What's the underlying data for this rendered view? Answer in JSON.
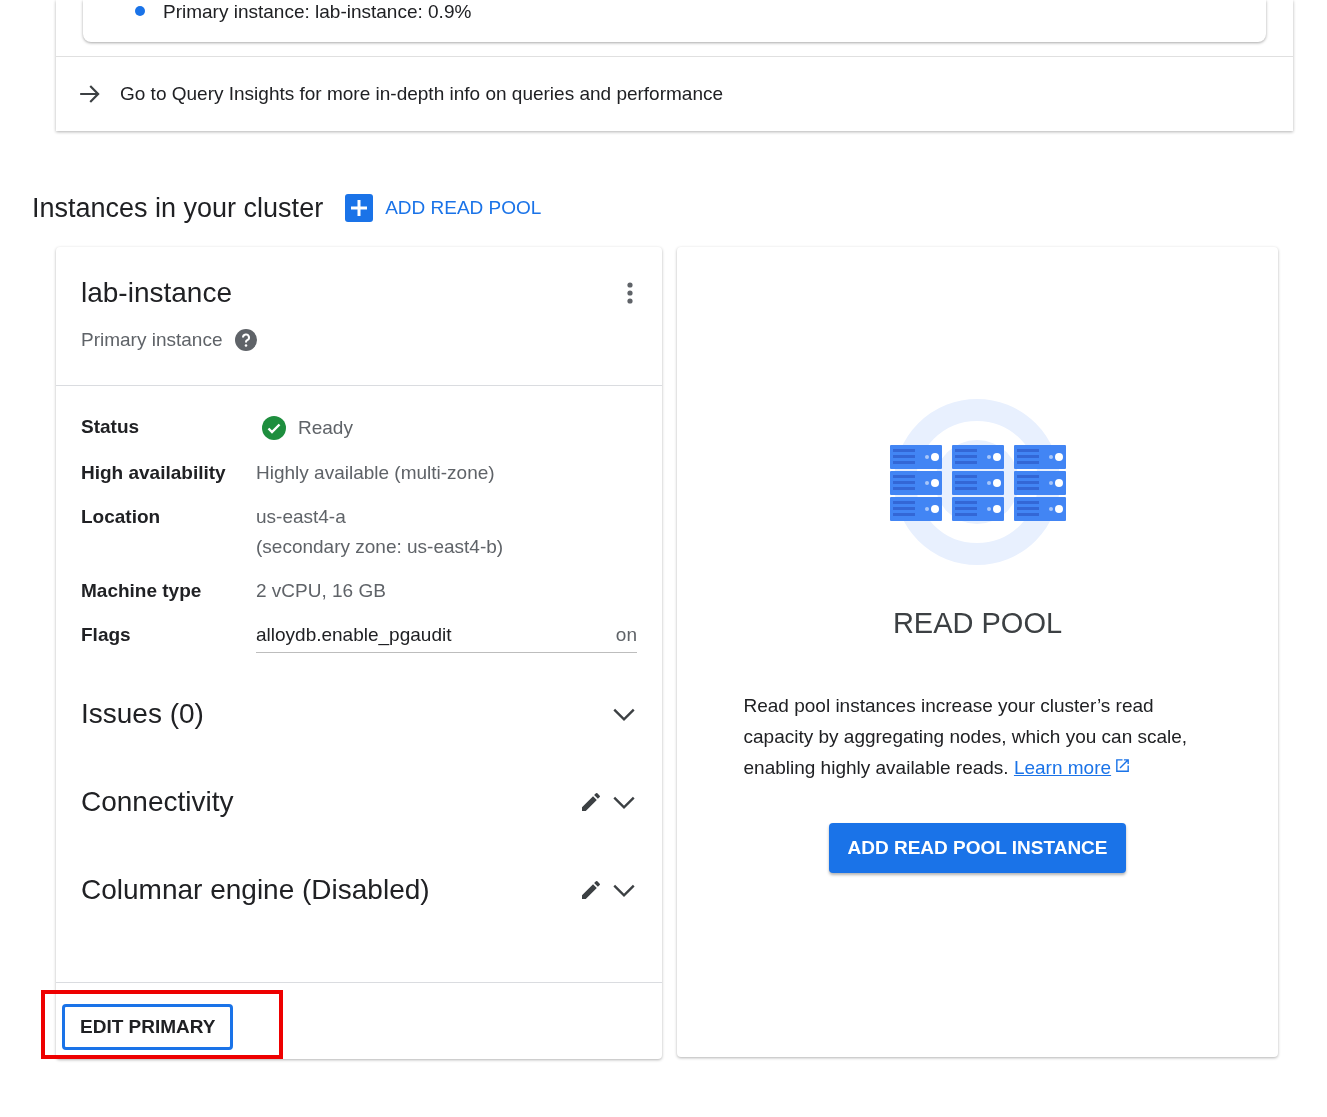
{
  "top_card": {
    "bullet_text": "Primary instance: lab-instance: 0.9%",
    "link_text": "Go to Query Insights for more in-depth info on queries and performance"
  },
  "instances": {
    "title": "Instances in your cluster",
    "add_button": "ADD READ POOL"
  },
  "primary": {
    "name": "lab-instance",
    "role": "Primary instance",
    "details": [
      {
        "label": "Status",
        "value": "Ready",
        "kind": "status"
      },
      {
        "label": "High availability",
        "value": "Highly available (multi-zone)",
        "kind": "text"
      },
      {
        "label": "Location",
        "value": "us-east4-a",
        "secondary": "(secondary zone: us-east4-b)",
        "kind": "text"
      },
      {
        "label": "Machine type",
        "value": "2 vCPU, 16 GB",
        "kind": "text"
      },
      {
        "label": "Flags",
        "kind": "flags",
        "flags": [
          {
            "name": "alloydb.enable_pgaudit",
            "value": "on"
          }
        ]
      }
    ],
    "sections": [
      {
        "title": "Issues (0)",
        "editable": false,
        "expanded": false
      },
      {
        "title": "Connectivity",
        "editable": true,
        "expanded": false
      },
      {
        "title": "Columnar engine (Disabled)",
        "editable": true,
        "expanded": false
      }
    ],
    "edit_button": {
      "label": "EDIT PRIMARY",
      "highlighted": true
    }
  },
  "read_pool": {
    "title": "READ POOL",
    "description": "Read pool instances increase your cluster’s read capacity by aggregating nodes, which you can scale, enabling highly available reads.",
    "link": "Learn more",
    "button": "ADD READ POOL INSTANCE"
  }
}
